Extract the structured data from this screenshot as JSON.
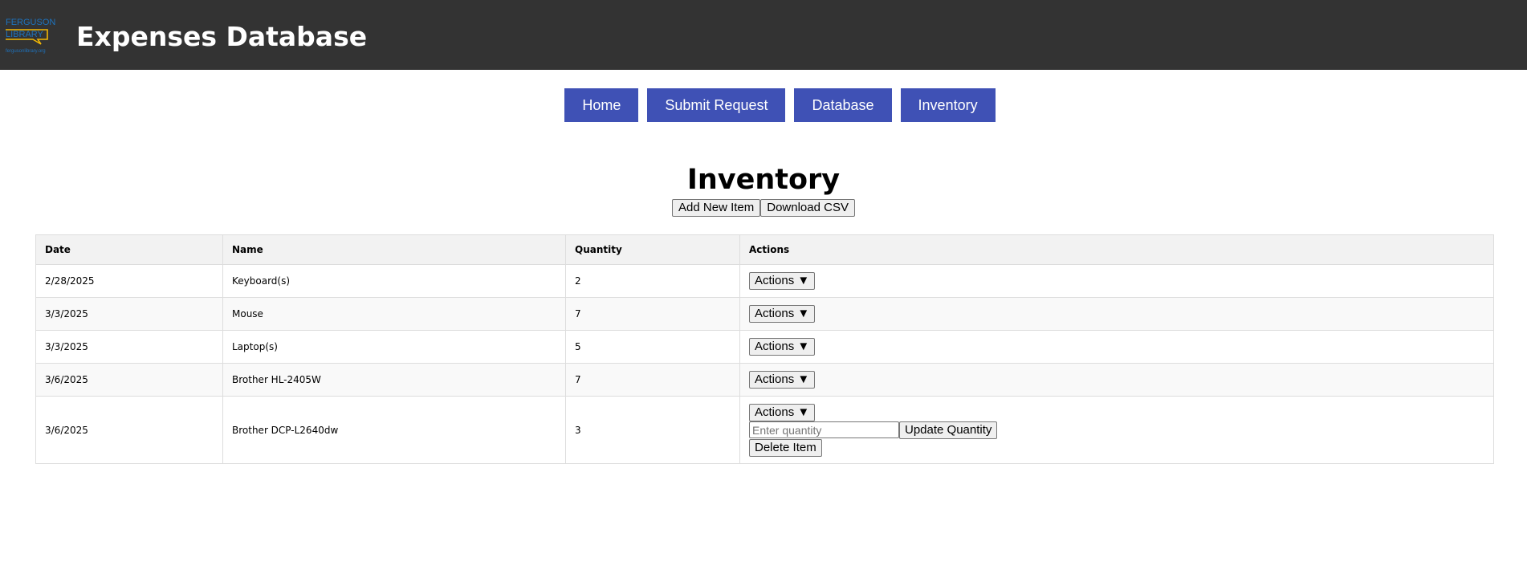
{
  "header": {
    "logo_text_top": "FERGUSON",
    "logo_text_bottom": "LIBRARY",
    "logo_url_text": "fergusonlibrary.org",
    "title": "Expenses Database"
  },
  "nav": {
    "items": [
      {
        "label": "Home"
      },
      {
        "label": "Submit Request"
      },
      {
        "label": "Database"
      },
      {
        "label": "Inventory"
      }
    ]
  },
  "page": {
    "heading": "Inventory",
    "add_new_label": "Add New Item",
    "download_csv_label": "Download CSV"
  },
  "table": {
    "columns": [
      "Date",
      "Name",
      "Quantity",
      "Actions"
    ],
    "rows": [
      {
        "date": "2/28/2025",
        "name": "Keyboard(s)",
        "quantity": "2",
        "actions_label": "Actions ▼"
      },
      {
        "date": "3/3/2025",
        "name": "Mouse",
        "quantity": "7",
        "actions_label": "Actions ▼"
      },
      {
        "date": "3/3/2025",
        "name": "Laptop(s)",
        "quantity": "5",
        "actions_label": "Actions ▼"
      },
      {
        "date": "3/6/2025",
        "name": "Brother HL-2405W",
        "quantity": "7",
        "actions_label": "Actions ▼"
      },
      {
        "date": "3/6/2025",
        "name": "Brother DCP-L2640dw",
        "quantity": "3",
        "actions_label": "Actions ▼",
        "expanded": {
          "quantity_placeholder": "Enter quantity",
          "update_label": "Update Quantity",
          "delete_label": "Delete Item"
        }
      }
    ]
  },
  "colors": {
    "header_bg": "#333333",
    "nav_bg": "#3f51b5",
    "logo_blue": "#1e73be",
    "logo_yellow": "#f2b705"
  }
}
